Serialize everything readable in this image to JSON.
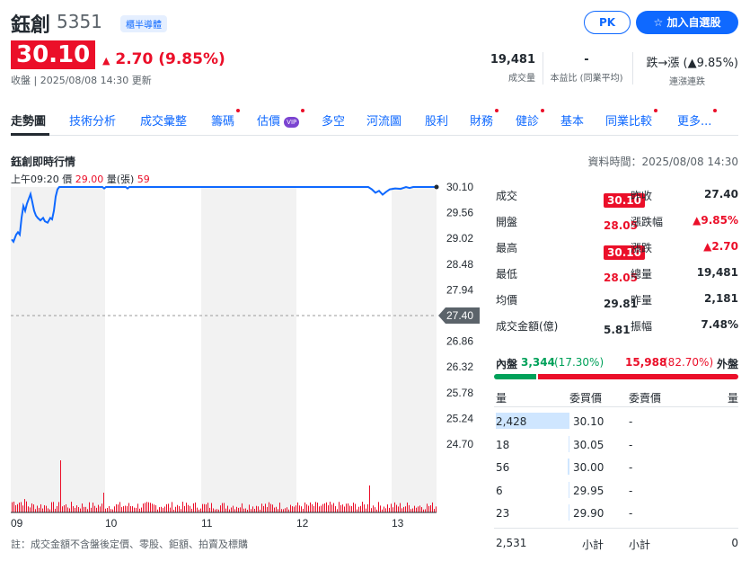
{
  "header": {
    "name": "鈺創",
    "code": "5351",
    "tag": "櫃半導體",
    "pk_label": "PK",
    "add_label": "加入自選股",
    "price": "30.10",
    "change": "2.70 (9.85%)",
    "status_time": "收盤 | 2025/08/08 14:30 更新"
  },
  "stats": [
    {
      "value": "19,481",
      "label": "成交量"
    },
    {
      "value": "-",
      "label": "本益比 (同業平均)"
    },
    {
      "value": "跌→漲 (▲9.85%)",
      "label": "連漲連跌"
    }
  ],
  "tabs": [
    "走勢圖",
    "技術分析",
    "成交彙整",
    "籌碼",
    "估價",
    "多空",
    "河流圖",
    "股利",
    "財務",
    "健診",
    "基本",
    "同業比較",
    "更多..."
  ],
  "section": {
    "title": "鈺創即時行情",
    "data_time": "資料時間：2025/08/08 14:30",
    "info_prefix": "上午09:20  價",
    "info_price": "29.00",
    "info_vol_label": "量(張)",
    "info_vol": "59"
  },
  "chart_data": {
    "type": "line",
    "x_labels": [
      "09",
      "10",
      "11",
      "12",
      "13"
    ],
    "y_ticks": [
      "30.10",
      "29.56",
      "29.02",
      "28.48",
      "27.94",
      "27.40",
      "26.86",
      "26.32",
      "25.78",
      "25.24",
      "24.70"
    ],
    "prev_close": "27.40",
    "ylim": [
      24.7,
      30.1
    ]
  },
  "quote_rows": [
    {
      "l1": "成交",
      "v1": "30.10",
      "l2": "昨收",
      "v2": "27.40"
    },
    {
      "l1": "開盤",
      "v1": "28.05",
      "l2": "漲跌幅",
      "v2": "▲9.85%"
    },
    {
      "l1": "最高",
      "v1": "30.10",
      "l2": "漲跌",
      "v2": "▲2.70"
    },
    {
      "l1": "最低",
      "v1": "28.05",
      "l2": "總量",
      "v2": "19,481"
    },
    {
      "l1": "均價",
      "v1": "29.81",
      "l2": "昨量",
      "v2": "2,181"
    },
    {
      "l1": "成交金額(億)",
      "v1": "5.81",
      "l2": "振幅",
      "v2": "7.48%"
    }
  ],
  "inout": {
    "inner_label": "內盤",
    "inner": "3,344",
    "inner_pct": "(17.30%)",
    "outer": "15,988",
    "outer_pct": "(82.70%)",
    "outer_label": "外盤",
    "inner_ratio": 0.173
  },
  "orderbook": {
    "headers": [
      "量",
      "委買價",
      "委賣價",
      "量"
    ],
    "rows": [
      {
        "qty": "2,428",
        "price": "30.10",
        "ask": "-",
        "aqty": ""
      },
      {
        "qty": "18",
        "price": "30.05",
        "ask": "-",
        "aqty": ""
      },
      {
        "qty": "56",
        "price": "30.00",
        "ask": "-",
        "aqty": ""
      },
      {
        "qty": "6",
        "price": "29.95",
        "ask": "-",
        "aqty": ""
      },
      {
        "qty": "23",
        "price": "29.90",
        "ask": "-",
        "aqty": ""
      }
    ],
    "total_qty": "2,531",
    "total_label": "小計",
    "total_label2": "小計",
    "total_ask": "0"
  },
  "note": "註：成交金額不含盤後定價、零股、鉅額、拍賣及標購"
}
